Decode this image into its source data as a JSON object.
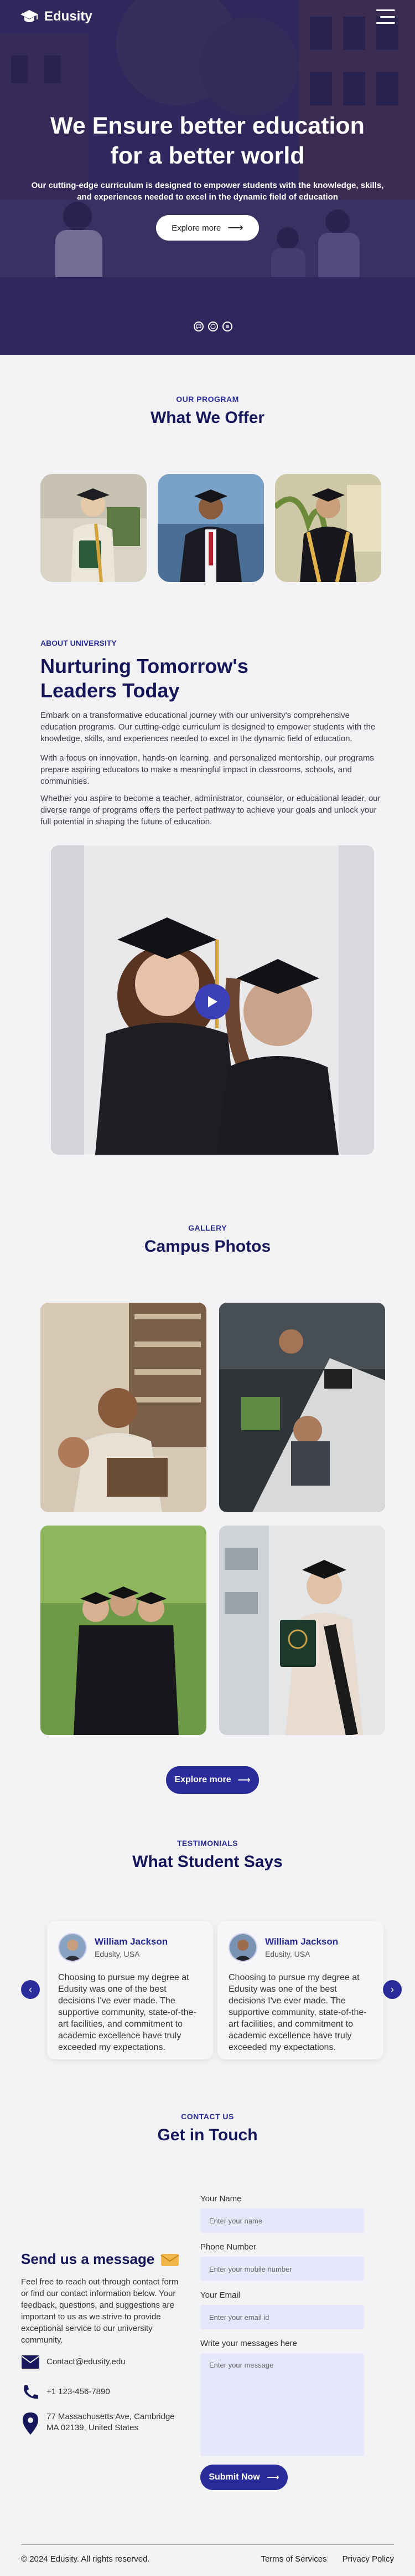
{
  "brand": {
    "name": "Edusity"
  },
  "hero": {
    "title": "We Ensure better education for a better world",
    "subtitle": "Our cutting-edge curriculum is designed to empower students with the knowledge, skills, and experiences needed to excel in the dynamic field of education",
    "button_label": "Explore more",
    "button_arrow": "⟶"
  },
  "program": {
    "tag": "OUR PROGRAM",
    "title": "What We Offer"
  },
  "about": {
    "tag": "ABOUT UNIVERSITY",
    "title": "Nurturing Tomorrow's Leaders Today",
    "paragraphs": [
      "Embark on a transformative educational journey with our university's comprehensive education programs. Our cutting-edge curriculum is designed to empower students with the knowledge, skills, and experiences needed to excel in the dynamic field of education.",
      "With a focus on innovation, hands-on learning, and personalized mentorship, our programs prepare aspiring educators to make a meaningful impact in classrooms, schools, and communities.",
      "Whether you aspire to become a teacher, administrator, counselor, or educational leader, our diverse range of programs offers the perfect pathway to achieve your goals and unlock your full potential in shaping the future of education."
    ]
  },
  "gallery": {
    "tag": "GALLERY",
    "title": "Campus Photos",
    "button_label": "Explore more",
    "button_arrow": "⟶"
  },
  "testimonials": {
    "tag": "TESTIMONIALS",
    "title": "What Student Says",
    "prev_icon": "‹",
    "next_icon": "›",
    "items": [
      {
        "name": "William Jackson",
        "location": "Edusity, USA",
        "text": "Choosing to pursue my degree at Edusity was one of the best decisions I've ever made. The supportive community, state-of-the-art facilities, and commitment to academic excellence have truly exceeded my expectations."
      },
      {
        "name": "William Jackson",
        "location": "Edusity, USA",
        "text": "Choosing to pursue my degree at Edusity was one of the best decisions I've ever made. The supportive community, state-of-the-art facilities, and commitment to academic excellence have truly exceeded my expectations."
      }
    ]
  },
  "contact": {
    "tag": "CONTACT US",
    "title": "Get in Touch",
    "side_title": "Send us a message",
    "side_text": "Feel free to reach out through contact form or find our contact information below. Your feedback, questions, and suggestions are important to us as we strive to provide exceptional service to our university community.",
    "email": "Contact@edusity.edu",
    "phone": "+1 123-456-7890",
    "address": "77 Massachusetts Ave, Cambridge MA 02139, United States",
    "form": {
      "name_label": "Your Name",
      "name_placeholder": "Enter your name",
      "phone_label": "Phone Number",
      "phone_placeholder": "Enter your mobile number",
      "email_label": "Your Email",
      "email_placeholder": "Enter your email id",
      "message_label": "Write your messages here",
      "message_placeholder": "Enter your message",
      "submit_label": "Submit Now",
      "submit_arrow": "⟶"
    }
  },
  "footer": {
    "copyright": "© 2024 Edusity. All rights reserved.",
    "links": [
      "Terms of Services",
      "Privacy Policy"
    ]
  },
  "colors": {
    "primary": "#2a2c9b",
    "heading": "#16175a",
    "input_bg": "#e6e7fb",
    "page_bg": "#f3f3f5"
  }
}
